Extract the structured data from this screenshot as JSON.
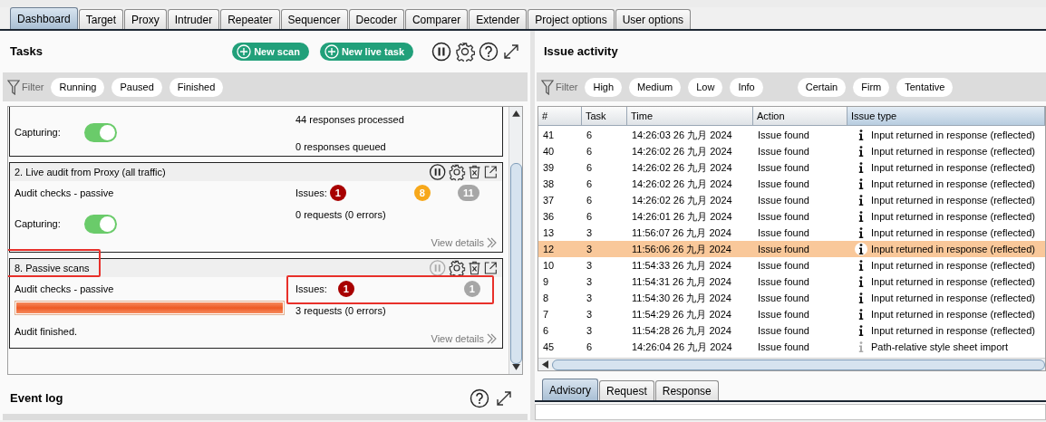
{
  "tabs": [
    {
      "label": "Dashboard",
      "selected": true
    },
    {
      "label": "Target",
      "selected": false
    },
    {
      "label": "Proxy",
      "selected": false
    },
    {
      "label": "Intruder",
      "selected": false
    },
    {
      "label": "Repeater",
      "selected": false
    },
    {
      "label": "Sequencer",
      "selected": false
    },
    {
      "label": "Decoder",
      "selected": false
    },
    {
      "label": "Comparer",
      "selected": false
    },
    {
      "label": "Extender",
      "selected": false
    },
    {
      "label": "Project options",
      "selected": false
    },
    {
      "label": "User options",
      "selected": false
    }
  ],
  "tasks": {
    "title": "Tasks",
    "buttons": [
      "New scan",
      "New live task"
    ],
    "filter": {
      "label": "Filter",
      "pills": [
        "Running",
        "Paused",
        "Finished"
      ]
    },
    "cards": [
      {
        "kind": "partial",
        "capturing": {
          "label": "Capturing:",
          "on": true
        },
        "stats": [
          "44 responses processed",
          "0 responses queued"
        ]
      },
      {
        "kind": "full",
        "title": "2. Live audit from Proxy (all traffic)",
        "pause_disabled": false,
        "checks": "Audit checks - passive",
        "issues": {
          "label": "Issues:",
          "badges": [
            {
              "kind": "high",
              "count": "1",
              "color": "#a80000"
            },
            {
              "kind": "medium",
              "count": "8",
              "color": "#f7a81b"
            },
            {
              "kind": "info",
              "count": "11",
              "color": "#a6a6a6"
            }
          ]
        },
        "stats": [
          "0 requests (0 errors)"
        ],
        "capturing": {
          "label": "Capturing:",
          "on": true
        },
        "view_details": "View details"
      },
      {
        "kind": "full",
        "title": "8. Passive scans",
        "pause_disabled": true,
        "title_highlighted": true,
        "checks": "Audit checks - passive",
        "issues": {
          "label": "Issues:",
          "highlighted": true,
          "badges": [
            {
              "kind": "high",
              "count": "1",
              "color": "#a80000"
            },
            {
              "kind": "info",
              "count": "1",
              "color": "#a6a6a6"
            }
          ]
        },
        "progress": {
          "level": 1
        },
        "stats": [
          "3 requests (0 errors)"
        ],
        "status": "Audit finished.",
        "view_details": "View details"
      }
    ]
  },
  "event_log": {
    "title": "Event log"
  },
  "issue_activity": {
    "title": "Issue activity",
    "filter": {
      "label": "Filter",
      "pills": [
        "High",
        "Medium",
        "Low",
        "Info"
      ],
      "pills_2": [
        "Certain",
        "Firm",
        "Tentative"
      ]
    },
    "table": {
      "columns": [
        {
          "label": "#",
          "sorted": false
        },
        {
          "label": "Task",
          "sorted": false
        },
        {
          "label": "Time",
          "sorted": false
        },
        {
          "label": "Action",
          "sorted": false
        },
        {
          "label": "Issue type",
          "sorted": true
        }
      ],
      "rows": [
        {
          "id": "41",
          "task": "6",
          "time": "14:26:03 26 九月 2024",
          "action": "Issue found",
          "issue": "Input returned in response (reflected)",
          "faded": false,
          "selected": false
        },
        {
          "id": "40",
          "task": "6",
          "time": "14:26:02 26 九月 2024",
          "action": "Issue found",
          "issue": "Input returned in response (reflected)",
          "faded": false,
          "selected": false
        },
        {
          "id": "39",
          "task": "6",
          "time": "14:26:02 26 九月 2024",
          "action": "Issue found",
          "issue": "Input returned in response (reflected)",
          "faded": false,
          "selected": false
        },
        {
          "id": "38",
          "task": "6",
          "time": "14:26:02 26 九月 2024",
          "action": "Issue found",
          "issue": "Input returned in response (reflected)",
          "faded": false,
          "selected": false
        },
        {
          "id": "37",
          "task": "6",
          "time": "14:26:02 26 九月 2024",
          "action": "Issue found",
          "issue": "Input returned in response (reflected)",
          "faded": false,
          "selected": false
        },
        {
          "id": "36",
          "task": "6",
          "time": "14:26:01 26 九月 2024",
          "action": "Issue found",
          "issue": "Input returned in response (reflected)",
          "faded": false,
          "selected": false
        },
        {
          "id": "13",
          "task": "3",
          "time": "11:56:07 26 九月 2024",
          "action": "Issue found",
          "issue": "Input returned in response (reflected)",
          "faded": false,
          "selected": false
        },
        {
          "id": "12",
          "task": "3",
          "time": "11:56:06 26 九月 2024",
          "action": "Issue found",
          "issue": "Input returned in response (reflected)",
          "faded": false,
          "selected": true
        },
        {
          "id": "10",
          "task": "3",
          "time": "11:54:33 26 九月 2024",
          "action": "Issue found",
          "issue": "Input returned in response (reflected)",
          "faded": false,
          "selected": false
        },
        {
          "id": "9",
          "task": "3",
          "time": "11:54:31 26 九月 2024",
          "action": "Issue found",
          "issue": "Input returned in response (reflected)",
          "faded": false,
          "selected": false
        },
        {
          "id": "8",
          "task": "3",
          "time": "11:54:30 26 九月 2024",
          "action": "Issue found",
          "issue": "Input returned in response (reflected)",
          "faded": false,
          "selected": false
        },
        {
          "id": "7",
          "task": "3",
          "time": "11:54:29 26 九月 2024",
          "action": "Issue found",
          "issue": "Input returned in response (reflected)",
          "faded": false,
          "selected": false
        },
        {
          "id": "6",
          "task": "3",
          "time": "11:54:28 26 九月 2024",
          "action": "Issue found",
          "issue": "Input returned in response (reflected)",
          "faded": false,
          "selected": false
        },
        {
          "id": "45",
          "task": "6",
          "time": "14:26:04 26 九月 2024",
          "action": "Issue found",
          "issue": "Path-relative style sheet import",
          "faded": true,
          "selected": false
        }
      ]
    }
  },
  "detail_tabs": [
    {
      "label": "Advisory",
      "selected": true
    },
    {
      "label": "Request",
      "selected": false
    },
    {
      "label": "Response",
      "selected": false
    }
  ]
}
